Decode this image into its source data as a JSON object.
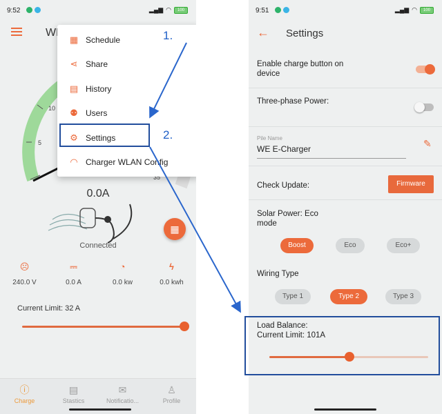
{
  "left": {
    "status": {
      "time": "9:52",
      "battery": "100"
    },
    "app_title": "WE",
    "gauge_ticks": [
      "5",
      "10",
      "35"
    ],
    "current": "0.0A",
    "connection": "Connected",
    "metrics": [
      {
        "icon": "plug-icon",
        "value": "240.0 V"
      },
      {
        "icon": "current-icon",
        "value": "0.0 A"
      },
      {
        "icon": "speedometer-icon",
        "value": "0.0 kw"
      },
      {
        "icon": "bolt-icon",
        "value": "0.0 kwh"
      }
    ],
    "current_limit": "Current Limit: 32 A",
    "tabs": [
      {
        "label": "Charge",
        "icon": "charge-tab-icon"
      },
      {
        "label": "Stastics",
        "icon": "statistics-tab-icon"
      },
      {
        "label": "Notificatio...",
        "icon": "notification-tab-icon"
      },
      {
        "label": "Profile",
        "icon": "profile-tab-icon"
      }
    ],
    "menu": [
      {
        "label": "Schedule",
        "icon": "calendar-icon"
      },
      {
        "label": "Share",
        "icon": "share-icon"
      },
      {
        "label": "History",
        "icon": "history-icon"
      },
      {
        "label": "Users",
        "icon": "users-icon"
      },
      {
        "label": "Settings",
        "icon": "gear-icon"
      },
      {
        "label": "Charger WLAN Config",
        "icon": "wifi-icon"
      }
    ],
    "callout_1": "1.",
    "callout_2": "2."
  },
  "right": {
    "status": {
      "time": "9:51",
      "battery": "100"
    },
    "title": "Settings",
    "enable_charge_label": "Enable charge button on device",
    "enable_charge_on": true,
    "three_phase_label": "Three-phase Power:",
    "three_phase_on": false,
    "pile_name_hint": "Pile Name",
    "pile_name_value": "WE E-Charger",
    "check_update_label": "Check Update:",
    "firmware_button": "Firmware",
    "solar_label": "Solar Power: Eco mode",
    "solar_options": [
      "Boost",
      "Eco",
      "Eco+"
    ],
    "solar_selected": "Boost",
    "wiring_label": "Wiring Type",
    "wiring_options": [
      "Type 1",
      "Type 2",
      "Type 3"
    ],
    "wiring_selected": "Type 2",
    "load_balance_label": "Load Balance:",
    "load_balance_limit": "Current Limit: 101A"
  },
  "colors": {
    "accent": "#ec6a3b",
    "annotation": "#1f5fc7",
    "gauge_green": "#9ed99a"
  }
}
